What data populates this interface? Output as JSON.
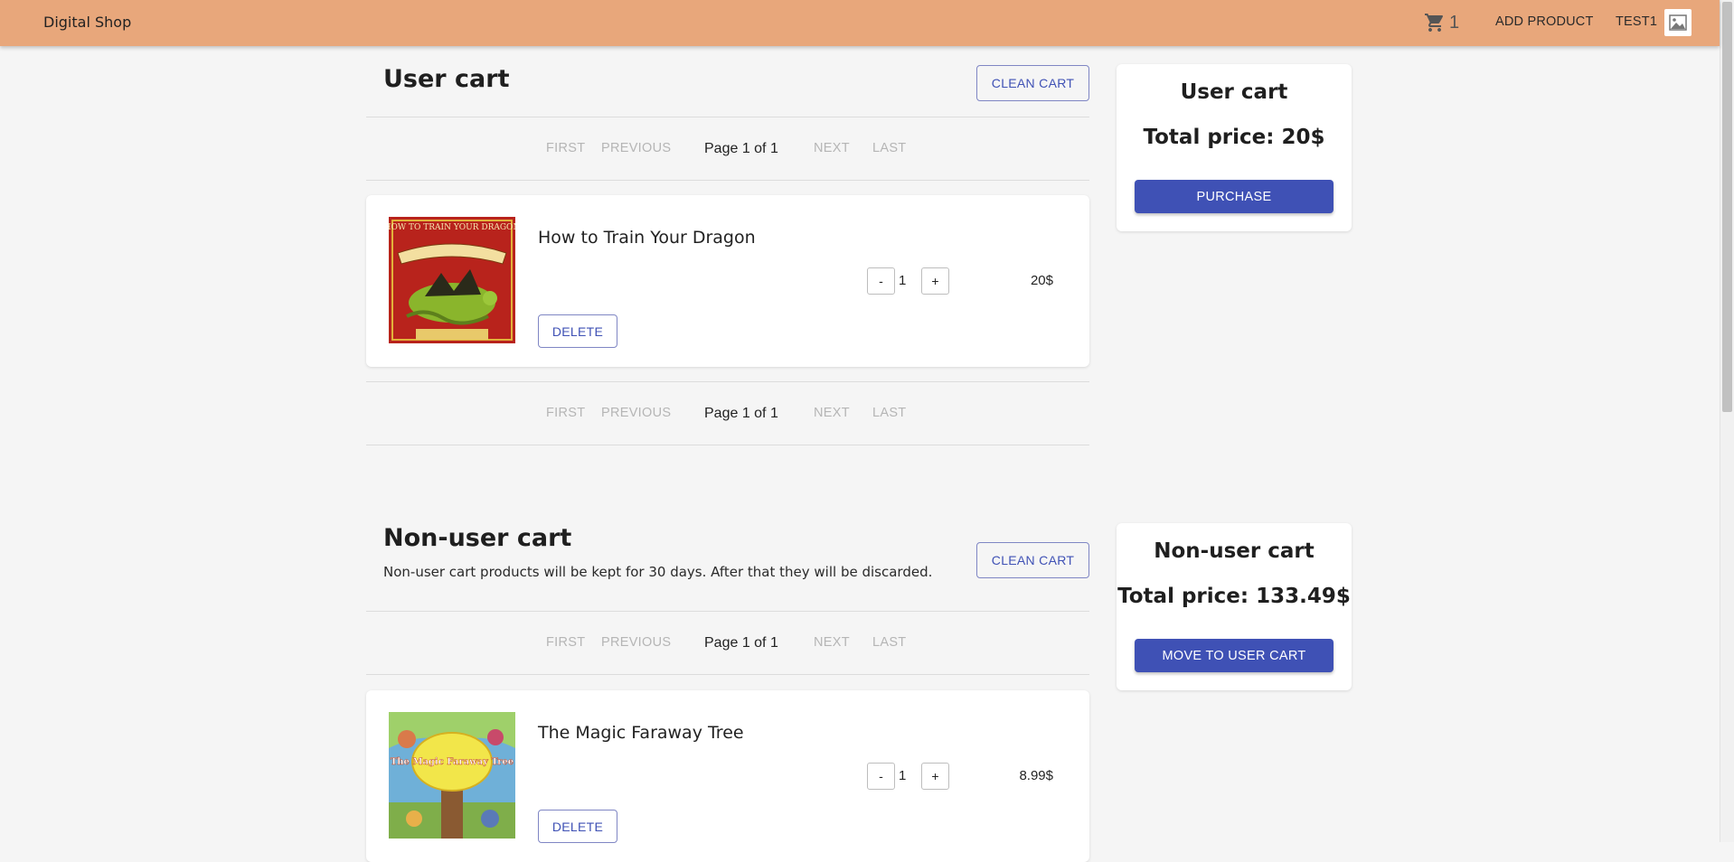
{
  "header": {
    "brand": "Digital Shop",
    "cart_count": "1",
    "add_product_label": "ADD PRODUCT",
    "username": "TEST1",
    "avatar_icon": "image-placeholder-icon",
    "cart_icon": "shopping-cart-icon"
  },
  "pagination_labels": {
    "first": "FIRST",
    "previous": "PREVIOUS",
    "next": "NEXT",
    "last": "LAST"
  },
  "user_cart": {
    "title": "User cart",
    "clean_label": "CLEAN CART",
    "page_info": "Page 1 of 1",
    "items": [
      {
        "name": "How to Train Your Dragon",
        "quantity": "1",
        "price": "20$",
        "decrement_label": "-",
        "increment_label": "+",
        "delete_label": "DELETE",
        "cover_text": "HOW TO TRAIN YOUR DRAGON"
      }
    ],
    "summary": {
      "title": "User cart",
      "total": "Total price: 20$",
      "action_label": "PURCHASE"
    }
  },
  "non_user_cart": {
    "title": "Non-user cart",
    "description": "Non-user cart products will be kept for 30 days. After that they will be discarded.",
    "clean_label": "CLEAN CART",
    "page_info": "Page 1 of 1",
    "items": [
      {
        "name": "The Magic Faraway Tree",
        "quantity": "1",
        "price": "8.99$",
        "decrement_label": "-",
        "increment_label": "+",
        "delete_label": "DELETE",
        "cover_text": "The Magic Faraway Tree"
      }
    ],
    "summary": {
      "title": "Non-user cart",
      "total": "Total price: 133.49$",
      "action_label": "MOVE TO USER CART"
    }
  },
  "colors": {
    "appbar": "#e8a77b",
    "primary": "#3f51b5",
    "background": "#f5f5f5"
  }
}
